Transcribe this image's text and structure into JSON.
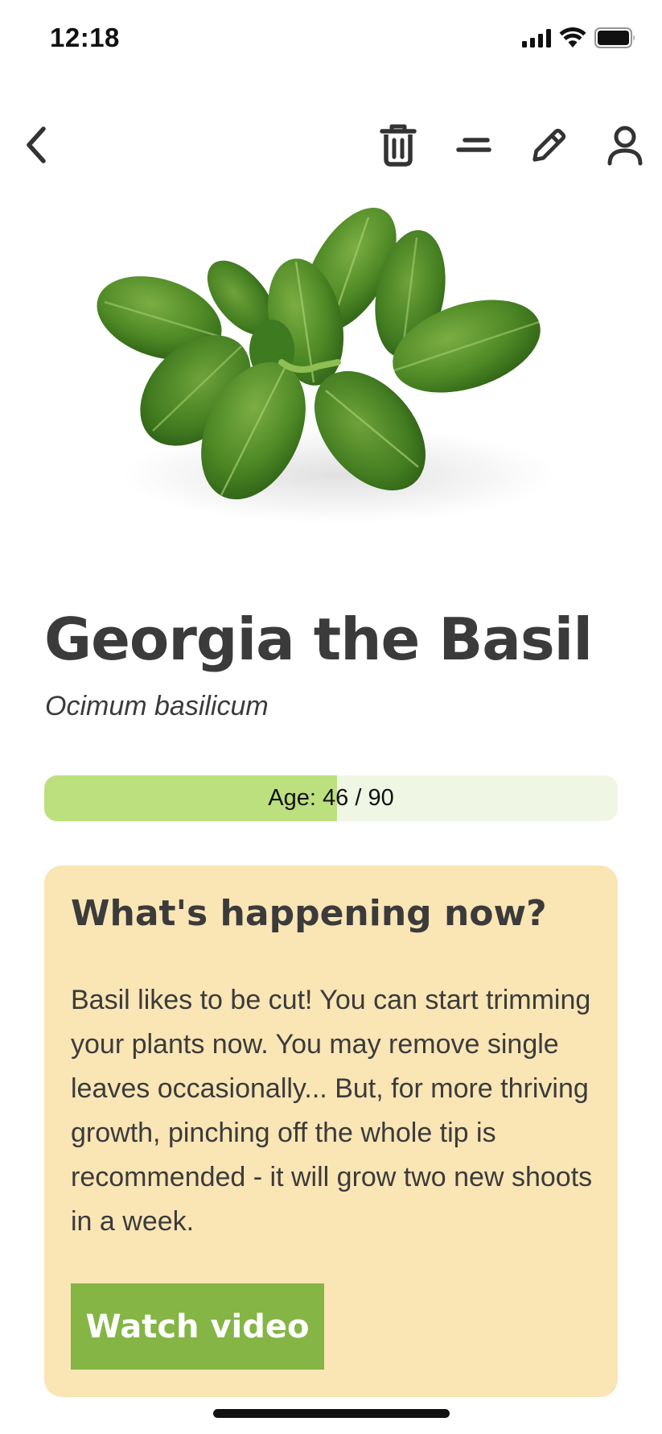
{
  "status_bar": {
    "time": "12:18",
    "icons": [
      "signal-icon",
      "wifi-icon",
      "battery-icon"
    ]
  },
  "nav": {
    "back_icon": "chevron-left-icon",
    "actions": [
      "trash-icon",
      "menu-icon",
      "pencil-icon",
      "user-icon"
    ]
  },
  "plant": {
    "name": "Georgia the Basil",
    "latin_name": "Ocimum basilicum",
    "image": "basil-leaves-image"
  },
  "age": {
    "label": "Age: 46 / 90",
    "current": 46,
    "total": 90,
    "fill_fraction": 0.511
  },
  "card": {
    "heading": "What's happening now?",
    "body": "Basil likes to be cut! You can start trimming your plants now. You may remove single leaves occasionally... But, for more thriving growth, pinching off the whole tip is recommended - it will grow two new shoots in a week.",
    "button_label": "Watch video"
  },
  "colors": {
    "age_fill": "#bde07f",
    "age_track": "#eff7e4",
    "card_bg": "#fae5b5",
    "button_bg": "#84b545",
    "text": "#3b3b3b"
  }
}
